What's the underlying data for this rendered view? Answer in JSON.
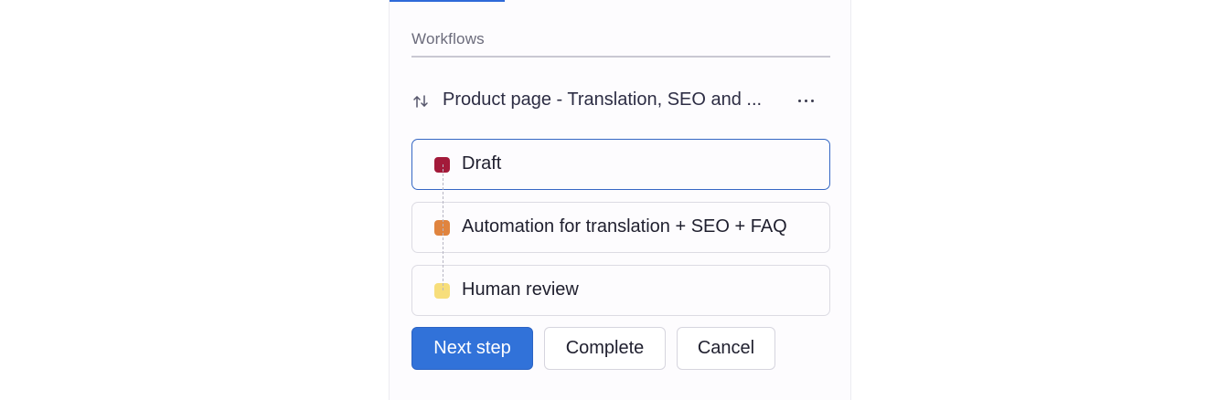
{
  "workflows": {
    "section_label": "Workflows",
    "workflow_title": "Product page - Translation, SEO and ...",
    "workflow_icon": "swap-arrows-icon",
    "more_icon": "more-horizontal-icon"
  },
  "steps": [
    {
      "label": "Draft",
      "color": "#a31a3a",
      "active": true
    },
    {
      "label": "Automation for translation + SEO + FAQ",
      "color": "#e0843f",
      "active": false
    },
    {
      "label": "Human review",
      "color": "#f7de7b",
      "active": false
    }
  ],
  "actions": {
    "next_step": "Next step",
    "complete": "Complete",
    "cancel": "Cancel"
  },
  "colors": {
    "accent": "#3172d9",
    "active_border": "#3567c4"
  }
}
